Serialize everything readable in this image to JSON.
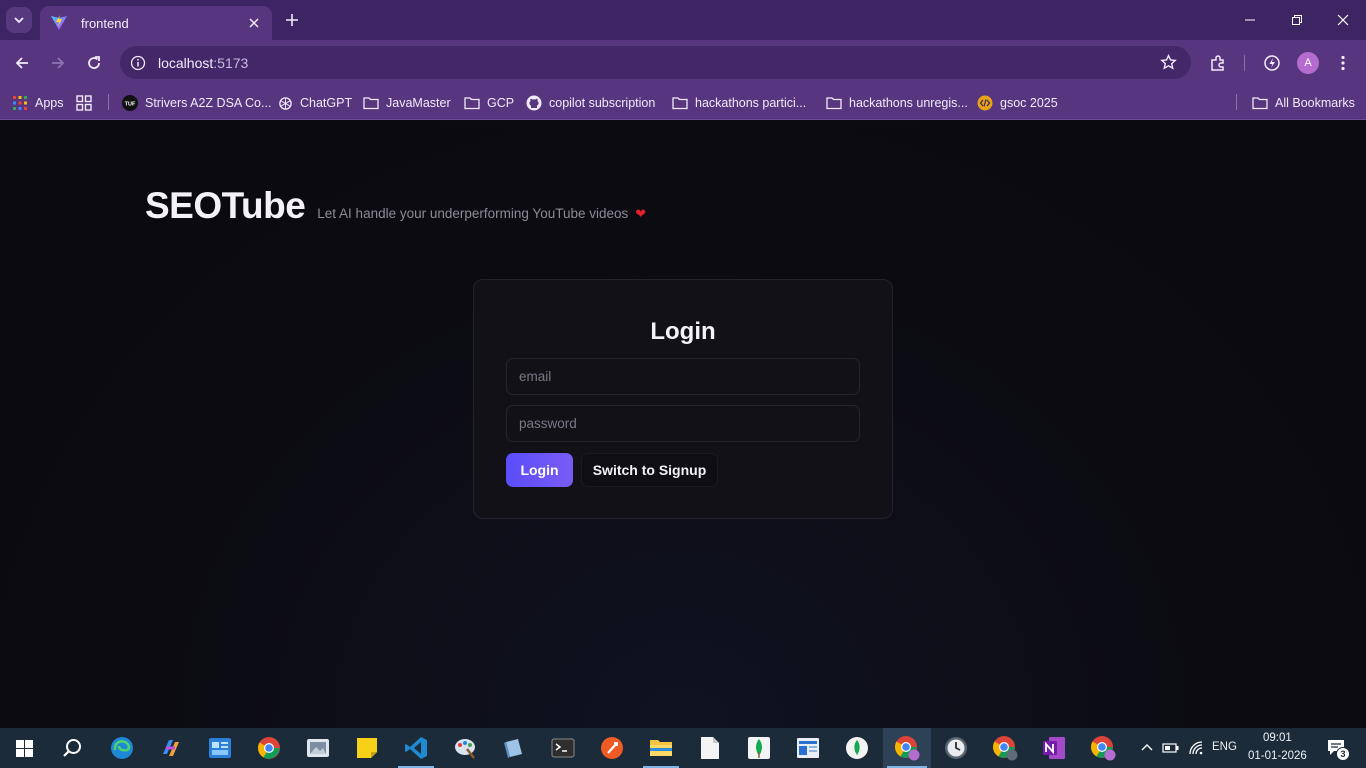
{
  "browser": {
    "tab_title": "frontend",
    "url_host": "localhost",
    "url_port": ":5173",
    "profile_initial": "A",
    "bookmarks": [
      {
        "label": "Apps",
        "icon": "apps-grid-icon"
      },
      {
        "label": "",
        "icon": "tab-groups-icon"
      },
      {
        "label": "Strivers A2Z DSA Co...",
        "icon": "tuf-logo-icon"
      },
      {
        "label": "ChatGPT",
        "icon": "chatgpt-icon"
      },
      {
        "label": "JavaMaster",
        "icon": "folder-icon"
      },
      {
        "label": "GCP",
        "icon": "folder-icon"
      },
      {
        "label": "copilot subscription",
        "icon": "github-icon"
      },
      {
        "label": "hackathons partici...",
        "icon": "folder-icon"
      },
      {
        "label": "hackathons unregis...",
        "icon": "folder-icon"
      },
      {
        "label": "gsoc 2025",
        "icon": "gsoc-icon"
      }
    ],
    "all_bookmarks": "All Bookmarks"
  },
  "page": {
    "brand": "SEOTube",
    "tagline": "Let AI handle your underperforming YouTube videos",
    "heart": "❤"
  },
  "login": {
    "title": "Login",
    "email_placeholder": "email",
    "password_placeholder": "password",
    "login_button": "Login",
    "switch_button": "Switch to Signup"
  },
  "taskbar": {
    "language": "ENG",
    "time": "09:01",
    "date": "01-01-2026",
    "notifications": "3"
  },
  "colors": {
    "accent_start": "#5a4dfb",
    "accent_end": "#7a5cf4",
    "chrome_purple": "#57357f",
    "heart_red": "#e0212b"
  }
}
